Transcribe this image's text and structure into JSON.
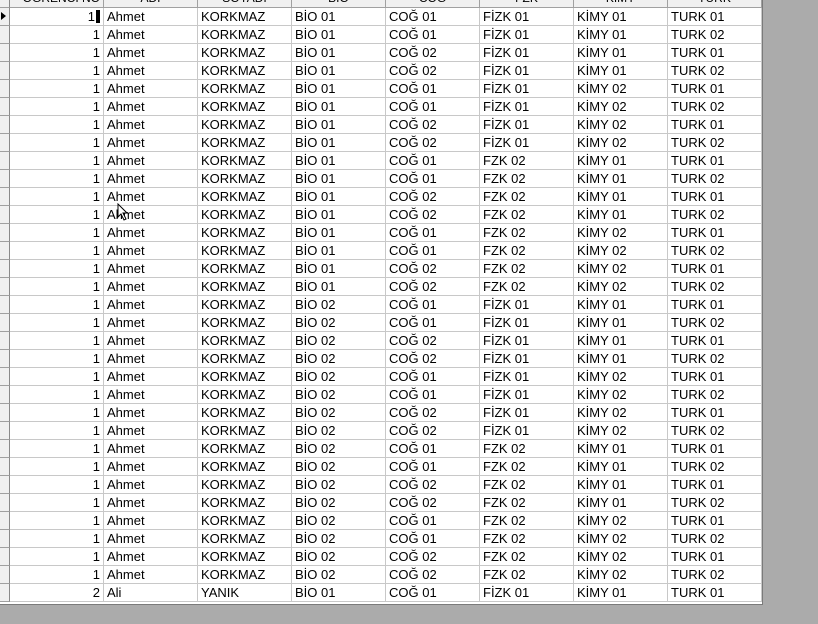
{
  "columns": [
    "ÖĞRENCİ NO",
    "ADI",
    "SOYADI",
    "BİO",
    "COĞ",
    "FZK",
    "KİMY",
    "TURK"
  ],
  "rows": [
    [
      "1",
      "Ahmet",
      "KORKMAZ",
      "BİO 01",
      "COĞ 01",
      "FİZK 01",
      "KİMY 01",
      "TURK 01"
    ],
    [
      "1",
      "Ahmet",
      "KORKMAZ",
      "BİO 01",
      "COĞ 01",
      "FİZK 01",
      "KİMY 01",
      "TURK 02"
    ],
    [
      "1",
      "Ahmet",
      "KORKMAZ",
      "BİO 01",
      "COĞ 02",
      "FİZK 01",
      "KİMY 01",
      "TURK 01"
    ],
    [
      "1",
      "Ahmet",
      "KORKMAZ",
      "BİO 01",
      "COĞ 02",
      "FİZK 01",
      "KİMY 01",
      "TURK 02"
    ],
    [
      "1",
      "Ahmet",
      "KORKMAZ",
      "BİO 01",
      "COĞ 01",
      "FİZK 01",
      "KİMY 02",
      "TURK 01"
    ],
    [
      "1",
      "Ahmet",
      "KORKMAZ",
      "BİO 01",
      "COĞ 01",
      "FİZK 01",
      "KİMY 02",
      "TURK 02"
    ],
    [
      "1",
      "Ahmet",
      "KORKMAZ",
      "BİO 01",
      "COĞ 02",
      "FİZK 01",
      "KİMY 02",
      "TURK 01"
    ],
    [
      "1",
      "Ahmet",
      "KORKMAZ",
      "BİO 01",
      "COĞ 02",
      "FİZK 01",
      "KİMY 02",
      "TURK 02"
    ],
    [
      "1",
      "Ahmet",
      "KORKMAZ",
      "BİO 01",
      "COĞ 01",
      "FZK 02",
      "KİMY 01",
      "TURK 01"
    ],
    [
      "1",
      "Ahmet",
      "KORKMAZ",
      "BİO 01",
      "COĞ 01",
      "FZK 02",
      "KİMY 01",
      "TURK 02"
    ],
    [
      "1",
      "Ahmet",
      "KORKMAZ",
      "BİO 01",
      "COĞ 02",
      "FZK 02",
      "KİMY 01",
      "TURK 01"
    ],
    [
      "1",
      "Ahmet",
      "KORKMAZ",
      "BİO 01",
      "COĞ 02",
      "FZK 02",
      "KİMY 01",
      "TURK 02"
    ],
    [
      "1",
      "Ahmet",
      "KORKMAZ",
      "BİO 01",
      "COĞ 01",
      "FZK 02",
      "KİMY 02",
      "TURK 01"
    ],
    [
      "1",
      "Ahmet",
      "KORKMAZ",
      "BİO 01",
      "COĞ 01",
      "FZK 02",
      "KİMY 02",
      "TURK 02"
    ],
    [
      "1",
      "Ahmet",
      "KORKMAZ",
      "BİO 01",
      "COĞ 02",
      "FZK 02",
      "KİMY 02",
      "TURK 01"
    ],
    [
      "1",
      "Ahmet",
      "KORKMAZ",
      "BİO 01",
      "COĞ 02",
      "FZK 02",
      "KİMY 02",
      "TURK 02"
    ],
    [
      "1",
      "Ahmet",
      "KORKMAZ",
      "BİO 02",
      "COĞ 01",
      "FİZK 01",
      "KİMY 01",
      "TURK 01"
    ],
    [
      "1",
      "Ahmet",
      "KORKMAZ",
      "BİO 02",
      "COĞ 01",
      "FİZK 01",
      "KİMY 01",
      "TURK 02"
    ],
    [
      "1",
      "Ahmet",
      "KORKMAZ",
      "BİO 02",
      "COĞ 02",
      "FİZK 01",
      "KİMY 01",
      "TURK 01"
    ],
    [
      "1",
      "Ahmet",
      "KORKMAZ",
      "BİO 02",
      "COĞ 02",
      "FİZK 01",
      "KİMY 01",
      "TURK 02"
    ],
    [
      "1",
      "Ahmet",
      "KORKMAZ",
      "BİO 02",
      "COĞ 01",
      "FİZK 01",
      "KİMY 02",
      "TURK 01"
    ],
    [
      "1",
      "Ahmet",
      "KORKMAZ",
      "BİO 02",
      "COĞ 01",
      "FİZK 01",
      "KİMY 02",
      "TURK 02"
    ],
    [
      "1",
      "Ahmet",
      "KORKMAZ",
      "BİO 02",
      "COĞ 02",
      "FİZK 01",
      "KİMY 02",
      "TURK 01"
    ],
    [
      "1",
      "Ahmet",
      "KORKMAZ",
      "BİO 02",
      "COĞ 02",
      "FİZK 01",
      "KİMY 02",
      "TURK 02"
    ],
    [
      "1",
      "Ahmet",
      "KORKMAZ",
      "BİO 02",
      "COĞ 01",
      "FZK 02",
      "KİMY 01",
      "TURK 01"
    ],
    [
      "1",
      "Ahmet",
      "KORKMAZ",
      "BİO 02",
      "COĞ 01",
      "FZK 02",
      "KİMY 01",
      "TURK 02"
    ],
    [
      "1",
      "Ahmet",
      "KORKMAZ",
      "BİO 02",
      "COĞ 02",
      "FZK 02",
      "KİMY 01",
      "TURK 01"
    ],
    [
      "1",
      "Ahmet",
      "KORKMAZ",
      "BİO 02",
      "COĞ 02",
      "FZK 02",
      "KİMY 01",
      "TURK 02"
    ],
    [
      "1",
      "Ahmet",
      "KORKMAZ",
      "BİO 02",
      "COĞ 01",
      "FZK 02",
      "KİMY 02",
      "TURK 01"
    ],
    [
      "1",
      "Ahmet",
      "KORKMAZ",
      "BİO 02",
      "COĞ 01",
      "FZK 02",
      "KİMY 02",
      "TURK 02"
    ],
    [
      "1",
      "Ahmet",
      "KORKMAZ",
      "BİO 02",
      "COĞ 02",
      "FZK 02",
      "KİMY 02",
      "TURK 01"
    ],
    [
      "1",
      "Ahmet",
      "KORKMAZ",
      "BİO 02",
      "COĞ 02",
      "FZK 02",
      "KİMY 02",
      "TURK 02"
    ],
    [
      "2",
      "Ali",
      "YANIK",
      "BİO 01",
      "COĞ 01",
      "FİZK 01",
      "KİMY 01",
      "TURK 01"
    ]
  ],
  "icons": {
    "row_indicator": "current-row-arrow-icon",
    "mouse_cursor": "mouse-pointer-icon"
  },
  "colors": {
    "grid_line": "#c8c8c8",
    "header_bg": "#f0f0f0",
    "outside_bg": "#ababab"
  }
}
